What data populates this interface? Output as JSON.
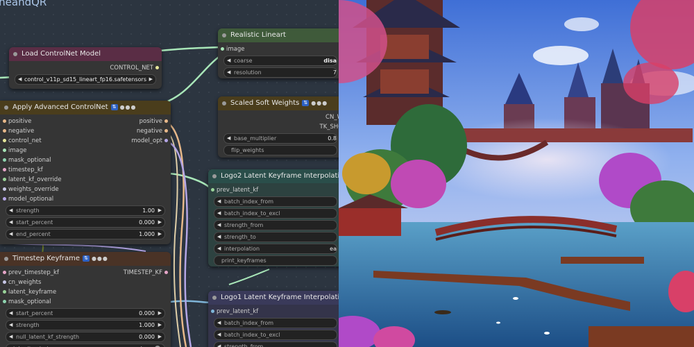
{
  "group": {
    "title": "ineandQR"
  },
  "nodes": {
    "realistic_lineart": {
      "title": "Realistic Lineart",
      "input": "image",
      "widgets": [
        {
          "label": "coarse",
          "value": "disa"
        },
        {
          "label": "resolution",
          "value": "7"
        }
      ]
    },
    "load_controlnet": {
      "title": "Load ControlNet Model",
      "output": "CONTROL_NET",
      "widget_value": "control_v11p_sd15_lineart_fp16.safetensors"
    },
    "apply_advanced": {
      "title": "Apply Advanced ControlNet",
      "badge": "🔖",
      "dots": "●●●",
      "io": [
        {
          "in": "positive",
          "out": "positive"
        },
        {
          "in": "negative",
          "out": "negative"
        },
        {
          "in": "control_net",
          "out": "model_opt"
        }
      ],
      "inputs": [
        "image",
        "mask_optional",
        "timestep_kf",
        "latent_kf_override",
        "weights_override",
        "model_optional"
      ],
      "widgets": [
        {
          "label": "strength",
          "value": "1.00"
        },
        {
          "label": "start_percent",
          "value": "0.000"
        },
        {
          "label": "end_percent",
          "value": "1.000"
        }
      ]
    },
    "scaled_soft": {
      "title": "Scaled Soft Weights",
      "badge": "🔖",
      "dots": "●●●",
      "outputs": [
        "CN_W",
        "TK_SHO"
      ],
      "widgets": [
        {
          "label": "base_multiplier",
          "value": "0.8"
        }
      ],
      "toggle_label": "flip_weights"
    },
    "logo2": {
      "title": "Logo2 Latent Keyframe Interpolation",
      "badge": "🔖",
      "input": "prev_latent_kf",
      "widgets": [
        {
          "label": "batch_index_from",
          "value": ""
        },
        {
          "label": "batch_index_to_excl",
          "value": ""
        },
        {
          "label": "strength_from",
          "value": ""
        },
        {
          "label": "strength_to",
          "value": ""
        },
        {
          "label": "interpolation",
          "value": "ea"
        }
      ],
      "toggle_label": "print_keyframes"
    },
    "timestep_kf": {
      "title": "Timestep Keyframe",
      "badge": "🔖",
      "dots": "●●●",
      "io_first": {
        "in": "prev_timestep_kf",
        "out": "TIMESTEP_KF"
      },
      "inputs": [
        "cn_weights",
        "latent_keyframe",
        "mask_optional"
      ],
      "widgets": [
        {
          "label": "start_percent",
          "value": "0.000"
        },
        {
          "label": "strength",
          "value": "1.000"
        },
        {
          "label": "null_latent_kf_strength",
          "value": "0.000"
        }
      ],
      "toggle": {
        "label": "inherit_missing",
        "value": "true"
      }
    },
    "logo1": {
      "title": "Logo1 Latent Keyframe Interpolation",
      "badge": "🔖",
      "input": "prev_latent_kf",
      "widgets": [
        {
          "label": "batch_index_from",
          "value": ""
        },
        {
          "label": "batch_index_to_excl",
          "value": ""
        },
        {
          "label": "strength_from",
          "value": ""
        }
      ]
    }
  },
  "colors": {
    "canvas": "#222222",
    "group": "#3f5a78",
    "node_body": "#353535",
    "title_lineart": "#3f5a3a",
    "title_loadcn": "#5a2d45",
    "title_apply": "#4a3d1c",
    "title_scaled": "#4a3d1c",
    "title_logo2": "#2a4e4a",
    "title_timestep": "#4a3326",
    "title_logo1": "#3a3a5a",
    "wire_green": "#a8e6b8",
    "wire_orange": "#e8b98a",
    "wire_purple": "#b4a6e6",
    "wire_blue": "#7fb5d9"
  },
  "image": {
    "semantic": "painting-of-pagoda-temple-with-bridge-and-cherry-blossoms"
  }
}
